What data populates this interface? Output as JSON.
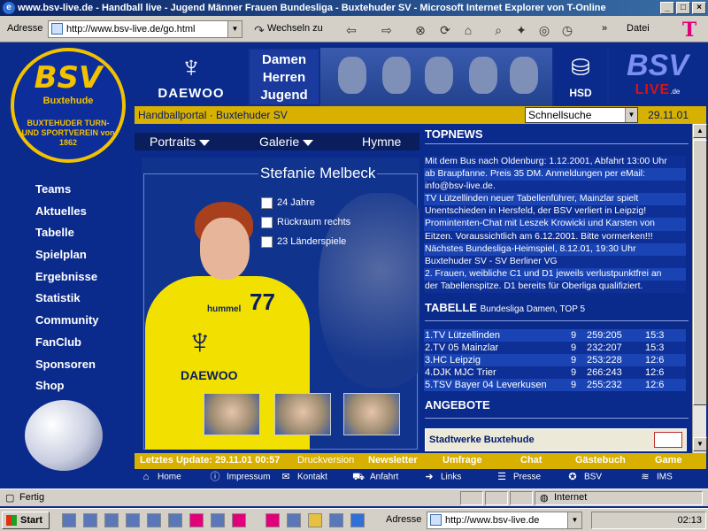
{
  "window": {
    "title": "www.bsv-live.de - Handball live - Jugend Männer Frauen Bundesliga - Buxtehuder SV - Microsoft Internet Explorer von T-Online",
    "min": "_",
    "max": "□",
    "close": "×"
  },
  "toolbar": {
    "address_label": "Adresse",
    "address_value": "http://www.bsv-live.de/go.html",
    "go_label": "Wechseln zu",
    "chevron": "»",
    "datei_label": "Datei",
    "tonline": "T"
  },
  "logo": {
    "title": "BSV",
    "city": "Buxtehude",
    "ring_text": "BUXTEHUDER TURN- UND SPORTVEREIN von 1862"
  },
  "header": {
    "sponsor": "DAEWOO",
    "categories": [
      "Damen",
      "Herren",
      "Jugend"
    ],
    "hsd": "HSD",
    "brand_main": "BSV",
    "brand_live": "LIVE",
    "brand_tld": ".de"
  },
  "breadcrumb": "Handballportal · Buxtehuder SV",
  "quicksearch": "Schnellsuche",
  "date": "29.11.01",
  "nav": [
    "Teams",
    "Aktuelles",
    "Tabelle",
    "Spielplan",
    "Ergebnisse",
    "Statistik",
    "Community",
    "FanClub",
    "Sponsoren",
    "Shop"
  ],
  "portrait_nav": {
    "portraits": "Portraits",
    "galerie": "Galerie",
    "hymne": "Hymne"
  },
  "player": {
    "name": "Stefanie Melbeck",
    "facts": [
      "24 Jahre",
      "Rückraum rechts",
      "23 Länderspiele"
    ],
    "jersey_number": "77",
    "jersey_brand": "DAEWOO",
    "jersey_maker": "hummel"
  },
  "topnews": {
    "heading": "TOPNEWS",
    "lines": [
      "Mit dem Bus nach Oldenburg: 1.12.2001, Abfahrt 13:00 Uhr",
      "ab Braupfanne. Preis 35 DM. Anmeldungen per eMail:",
      "info@bsv-live.de.",
      "TV Lützellinden neuer Tabellenführer, Mainzlar spielt",
      "Unentschieden in Hersfeld, der BSV verliert in Leipzig!",
      "Promintenten-Chat mit Leszek Krowicki und Karsten von",
      "Eitzen. Voraussichtlich am 6.12.2001. Bitte vormerken!!!",
      "Nächstes Bundesliga-Heimspiel, 8.12.01, 19:30 Uhr",
      "Buxtehuder SV - SV Berliner VG",
      "2. Frauen, weibliche C1 und D1 jeweils verlustpunktfrei an",
      "der Tabellenspitze. D1 bereits für Oberliga qualifiziert."
    ]
  },
  "tabelle": {
    "heading": "TABELLE",
    "subheading": "Bundesliga Damen, TOP 5",
    "rows": [
      [
        "1.TV Lützellinden",
        "9",
        "259:205",
        "15:3"
      ],
      [
        "2.TV 05 Mainzlar",
        "9",
        "232:207",
        "15:3"
      ],
      [
        "3.HC Leipzig",
        "9",
        "253:228",
        "12:6"
      ],
      [
        "4.DJK MJC Trier",
        "9",
        "266:243",
        "12:6"
      ],
      [
        "5.TSV Bayer 04 Leverkusen",
        "9",
        "255:232",
        "12:6"
      ]
    ]
  },
  "angebote": {
    "heading": "ANGEBOTE",
    "item": "Stadtwerke Buxtehude"
  },
  "update_bar": {
    "last_update": "Letztes Update: 29.11.01 00:57",
    "print": "Druckversion",
    "links": [
      "Newsletter",
      "Umfrage",
      "Chat",
      "Gästebuch",
      "Game"
    ]
  },
  "bottom_links": [
    "Home",
    "Impressum",
    "Kontakt",
    "Anfahrt",
    "Links",
    "Presse",
    "BSV",
    "IMS"
  ],
  "status": {
    "text": "Fertig",
    "zone": "Internet"
  },
  "taskbar": {
    "start": "Start",
    "address_label": "Adresse",
    "address_value": "http://www.bsv-live.de",
    "clock": "02:13"
  },
  "colors": {
    "navy": "#0a2a8c",
    "gold": "#d8b000",
    "jersey_yellow": "#f2e000"
  }
}
